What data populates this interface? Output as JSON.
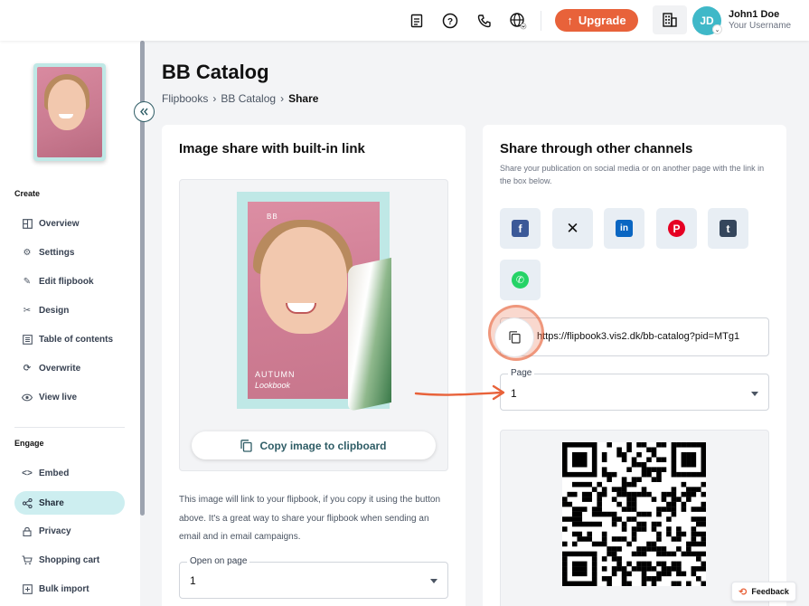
{
  "header": {
    "upgrade_label": "Upgrade",
    "user_initials": "JD",
    "user_name": "John1 Doe",
    "user_subtitle": "Your Username",
    "icons": [
      "document-icon",
      "help-icon",
      "phone-icon",
      "globe-icon",
      "building-icon"
    ],
    "accent_color": "#e8623a"
  },
  "sidebar": {
    "sections": [
      {
        "title": "Create",
        "items": [
          {
            "label": "Overview",
            "icon": "layout-icon"
          },
          {
            "label": "Settings",
            "icon": "gear-icon"
          },
          {
            "label": "Edit flipbook",
            "icon": "pencil-icon"
          },
          {
            "label": "Design",
            "icon": "tools-icon"
          },
          {
            "label": "Table of contents",
            "icon": "list-icon"
          },
          {
            "label": "Overwrite",
            "icon": "refresh-icon"
          },
          {
            "label": "View live",
            "icon": "eye-icon"
          }
        ]
      },
      {
        "title": "Engage",
        "items": [
          {
            "label": "Embed",
            "icon": "code-icon"
          },
          {
            "label": "Share",
            "icon": "share-icon",
            "active": true
          },
          {
            "label": "Privacy",
            "icon": "lock-icon"
          },
          {
            "label": "Shopping cart",
            "icon": "cart-icon"
          },
          {
            "label": "Bulk import",
            "icon": "import-icon"
          }
        ]
      }
    ],
    "active_color": "#cdeef0"
  },
  "main": {
    "title": "BB Catalog",
    "breadcrumb": [
      "Flipbooks",
      "BB Catalog",
      "Share"
    ],
    "image_share": {
      "title": "Image share with built-in link",
      "cover_brand": "BB",
      "cover_line1": "AUTUMN",
      "cover_line2": "Lookbook",
      "copy_button": "Copy image to clipboard",
      "description": "This image will link to your flipbook, if you copy it using the button above. It's a great way to share your flipbook when sending an email and in email campaigns.",
      "open_on_page_label": "Open on page",
      "open_on_page_value": "1"
    },
    "other_channels": {
      "title": "Share through other channels",
      "subtitle": "Share your publication on social media or on another page with the link in the box below.",
      "socials": [
        {
          "name": "facebook",
          "glyph": "f",
          "color": "#3b5998"
        },
        {
          "name": "x",
          "glyph": "𝕏",
          "color": "#111111"
        },
        {
          "name": "linkedin",
          "glyph": "in",
          "color": "#0a66c2"
        },
        {
          "name": "pinterest",
          "glyph": "P",
          "color": "#e60023"
        },
        {
          "name": "tumblr",
          "glyph": "t",
          "color": "#35465c"
        },
        {
          "name": "whatsapp",
          "glyph": "✆",
          "color": "#25d366"
        }
      ],
      "link": "https://flipbook3.vis2.dk/bb-catalog?pid=MTg1",
      "page_label": "Page",
      "page_value": "1"
    }
  },
  "feedback_label": "Feedback"
}
